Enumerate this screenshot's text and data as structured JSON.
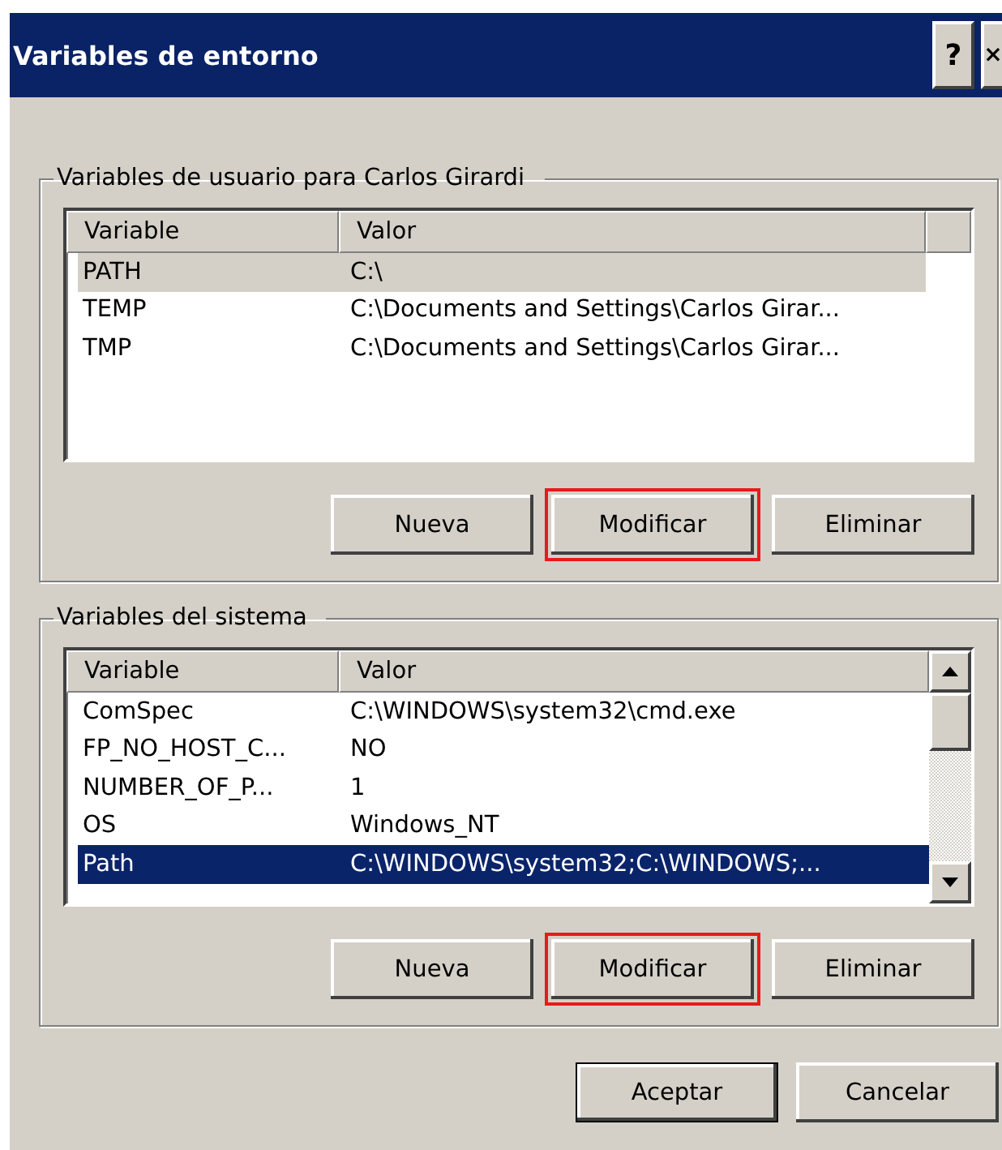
{
  "window": {
    "title": "Variables de entorno",
    "title_buttons": [
      "?",
      "×"
    ]
  },
  "groups": [
    {
      "legend": "Variables de usuario para Carlos Girardi",
      "focused": false,
      "scrollbar": false,
      "columns": [
        "Variable",
        "Valor"
      ],
      "rows": [
        {
          "name": "PATH",
          "value": "C:\\",
          "selected": true
        },
        {
          "name": "TEMP",
          "value": "C:\\Documents and Settings\\Carlos Girar...",
          "selected": false
        },
        {
          "name": "TMP",
          "value": "C:\\Documents and Settings\\Carlos Girar...",
          "selected": false
        }
      ],
      "buttons": [
        {
          "label": "Nueva",
          "highlighted": false
        },
        {
          "label": "Modificar",
          "highlighted": true
        },
        {
          "label": "Eliminar",
          "highlighted": false
        }
      ]
    },
    {
      "legend": "Variables del sistema",
      "focused": true,
      "scrollbar": true,
      "columns": [
        "Variable",
        "Valor"
      ],
      "rows": [
        {
          "name": "ComSpec",
          "value": "C:\\WINDOWS\\system32\\cmd.exe",
          "selected": false
        },
        {
          "name": "FP_NO_HOST_C...",
          "value": "NO",
          "selected": false
        },
        {
          "name": "NUMBER_OF_P...",
          "value": "1",
          "selected": false
        },
        {
          "name": "OS",
          "value": "Windows_NT",
          "selected": false
        },
        {
          "name": "Path",
          "value": "C:\\WINDOWS\\system32;C:\\WINDOWS;...",
          "selected": true
        }
      ],
      "buttons": [
        {
          "label": "Nueva",
          "highlighted": false
        },
        {
          "label": "Modificar",
          "highlighted": true
        },
        {
          "label": "Eliminar",
          "highlighted": false
        }
      ]
    }
  ],
  "footer_buttons": [
    {
      "label": "Aceptar",
      "default": true
    },
    {
      "label": "Cancelar",
      "default": false
    }
  ]
}
